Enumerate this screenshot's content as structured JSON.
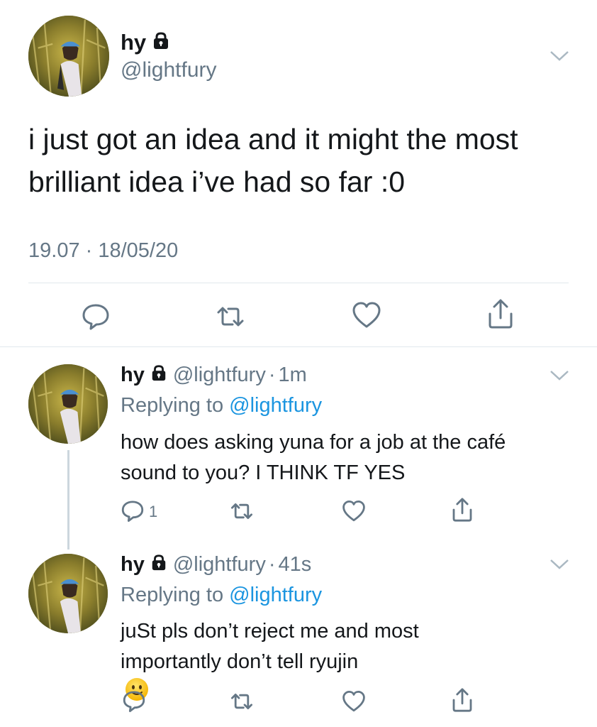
{
  "main_tweet": {
    "name": "hy",
    "handle": "@lightfury",
    "text_lines": [
      "i just got an idea and it might the most",
      "brilliant idea i’ve had so far :0"
    ],
    "timestamp": "19.07 · 18/05/20",
    "icons": [
      "lock-icon",
      "chevron-down-icon",
      "reply-icon",
      "retweet-icon",
      "like-icon",
      "share-icon"
    ]
  },
  "replies": [
    {
      "name": "hy",
      "handle": "@lightfury",
      "dot": "·",
      "time": "1m",
      "replying_prefix": "Replying to",
      "replying_to": "@lightfury",
      "text_lines": [
        "how does asking yuna for a job at the café",
        "sound to you? I THINK TF YES"
      ],
      "reply_count": "1"
    },
    {
      "name": "hy",
      "handle": "@lightfury",
      "dot": "·",
      "time": "41s",
      "replying_prefix": "Replying to",
      "replying_to": "@lightfury",
      "text_lines": [
        "juSt pls don’t reject me and most",
        "importantly don’t tell ryujin"
      ],
      "emoji": "slightly-smiling-face"
    }
  ],
  "colors": {
    "text": "#14171a",
    "secondary": "#657786",
    "link": "#1b95e0",
    "divider": "#e1e8ed",
    "thread_line": "#ccd6dd"
  }
}
